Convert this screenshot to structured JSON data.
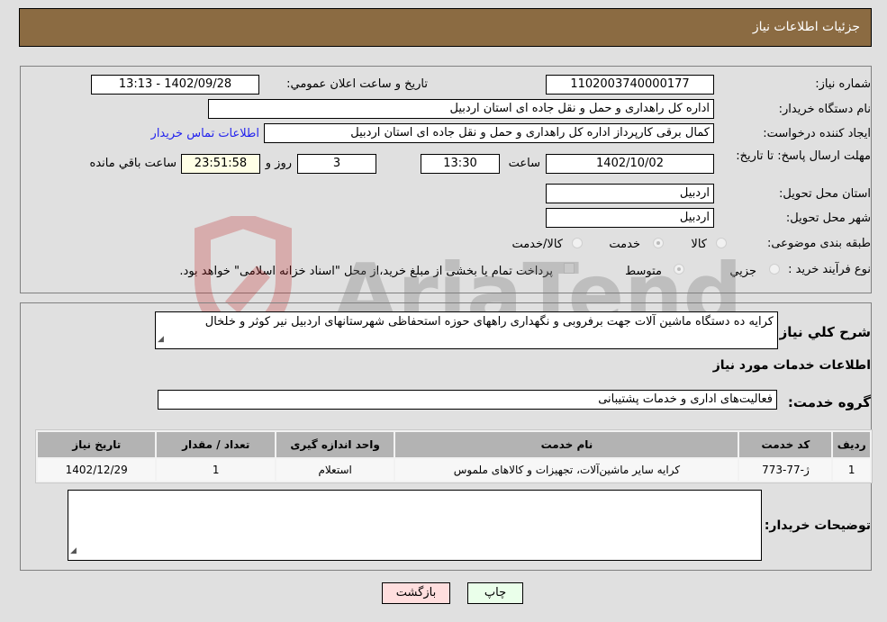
{
  "header": {
    "title": "جزئیات اطلاعات نیاز"
  },
  "form": {
    "need_number": {
      "label": "شماره نیاز:",
      "value": "1102003740000177"
    },
    "announce_datetime": {
      "label": "تاریخ و ساعت اعلان عمومي:",
      "value": "1402/09/28 - 13:13"
    },
    "buyer_org": {
      "label": "نام دستگاه خریدار:",
      "value": "اداره کل راهداری و حمل و نقل جاده ای استان اردبیل"
    },
    "requester": {
      "label": "ایجاد کننده درخواست:",
      "value": "کمال برقی کارپرداز اداره کل راهداری و حمل و نقل جاده ای استان اردبیل"
    },
    "buyer_contact_link": "اطلاعات تماس خریدار",
    "deadline": {
      "label": "مهلت ارسال پاسخ: تا تاریخ:",
      "date": "1402/10/02",
      "time_label": "ساعت",
      "time": "13:30",
      "days": "3",
      "days_label": "روز و",
      "remaining": "23:51:58",
      "remaining_label": "ساعت باقي مانده"
    },
    "delivery_province": {
      "label": "استان محل تحویل:",
      "value": "اردبیل"
    },
    "delivery_city": {
      "label": "شهر محل تحویل:",
      "value": "اردبیل"
    },
    "category": {
      "label": "طبقه بندی موضوعی:",
      "options": [
        "کالا",
        "خدمت",
        "کالا/خدمت"
      ],
      "selected": "خدمت"
    },
    "purchase_type": {
      "label": "نوع فرآیند خرید :",
      "options": [
        "جزيي",
        "متوسط"
      ],
      "selected": "متوسط",
      "treasury_checkbox_label": "پرداخت تمام یا بخشی از مبلغ خرید،از محل \"اسناد خزانه اسلامی\" خواهد بود.",
      "treasury_checked": false
    }
  },
  "details": {
    "description_label": "شرح کلي نیاز:",
    "description": "کرایه ده دستگاه ماشین آلات جهت برفروبی و نگهداری راههای حوزه استحفاظی شهرستانهای اردبیل نیر کوثر و خلخال",
    "services_title": "اطلاعات خدمات مورد نیاز",
    "service_group_label": "گروه خدمت:",
    "service_group": "فعالیت‌های اداری و خدمات پشتیبانی",
    "table": {
      "headers": [
        "ردیف",
        "کد خدمت",
        "نام خدمت",
        "واحد اندازه گیری",
        "تعداد / مقدار",
        "تاریخ نیاز"
      ],
      "rows": [
        [
          "1",
          "ژ-77-773",
          "کرایه سایر ماشین‌آلات، تجهیزات و کالاهای ملموس",
          "استعلام",
          "1",
          "1402/12/29"
        ]
      ]
    },
    "buyer_notes_label": "توضیحات خریدار:",
    "buyer_notes": ""
  },
  "buttons": {
    "print": "چاپ",
    "back": "بازگشت"
  },
  "colors": {
    "header_bg": "#8b6b42",
    "print_bg": "#eaffea",
    "back_bg": "#ffdede",
    "link": "#2323ee"
  },
  "watermark": {
    "text": "AriaTender.neT"
  }
}
